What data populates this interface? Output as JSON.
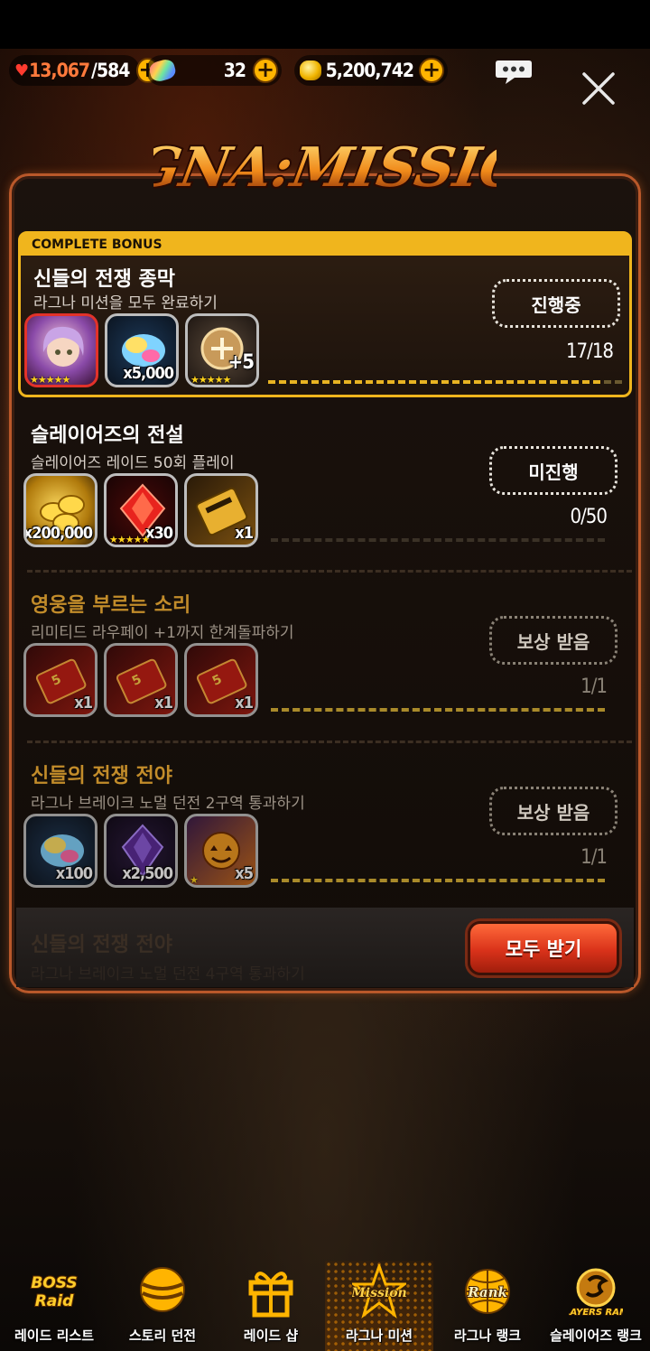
{
  "resources": {
    "stamina_current": "13,067",
    "stamina_max": "/584",
    "gems": "32",
    "gold": "5,200,742"
  },
  "title_logo_text": "RAGNA:MISSION",
  "missions": [
    {
      "section_label": "COMPLETE BONUS",
      "title": "신들의 전쟁 종막",
      "desc": "라그나 미션을 모두 완료하기",
      "button": "진행중",
      "progress": "17/18",
      "progress_fraction": 0.94,
      "rewards": [
        {
          "icon": "hero-portrait-icon",
          "qty": "",
          "stars": "★★★★★"
        },
        {
          "icon": "rainbow-gem-icon",
          "qty": "x5,000",
          "stars": ""
        },
        {
          "icon": "plus5-enhance-icon",
          "qty": "+5",
          "stars": "★★★★★"
        }
      ]
    },
    {
      "title": "슬레이어즈의 전설",
      "desc": "슬레이어즈 레이드 50회 플레이",
      "button": "미진행",
      "progress": "0/50",
      "progress_fraction": 0,
      "rewards": [
        {
          "icon": "gold-coins-icon",
          "qty": "x200,000",
          "stars": ""
        },
        {
          "icon": "red-crystal-icon",
          "qty": "x30",
          "stars": "★★★★★"
        },
        {
          "icon": "gold-ticket-icon",
          "qty": "x1",
          "stars": ""
        }
      ]
    },
    {
      "title": "영웅을 부르는 소리",
      "desc": "리미티드 라우페이 +1까지 한계돌파하기",
      "button": "보상 받음",
      "progress": "1/1",
      "progress_fraction": 1,
      "rewards": [
        {
          "icon": "red-ticket-icon",
          "qty": "x1",
          "stars": ""
        },
        {
          "icon": "red-ticket-icon",
          "qty": "x1",
          "stars": ""
        },
        {
          "icon": "red-ticket-icon",
          "qty": "x1",
          "stars": ""
        }
      ]
    },
    {
      "title": "신들의 전쟁 전야",
      "desc": "라그나 브레이크 노멀 던전 2구역 통과하기",
      "button": "보상 받음",
      "progress": "1/1",
      "progress_fraction": 1,
      "rewards": [
        {
          "icon": "rainbow-gem-icon",
          "qty": "x100",
          "stars": ""
        },
        {
          "icon": "purple-crystal-icon",
          "qty": "x2,500",
          "stars": ""
        },
        {
          "icon": "pumpkin-ticket-icon",
          "qty": "x5",
          "stars": "★"
        }
      ]
    }
  ],
  "ghost_row": {
    "title": "신들의 전쟁 전야",
    "desc": "라그나 브레이크 노멀 던전 4구역 통과하기"
  },
  "claim_all_label": "모두 받기",
  "nav": [
    {
      "label": "레이드 리스트",
      "icon": "boss-raid-icon",
      "active": false
    },
    {
      "label": "스토리 던전",
      "icon": "story-orb-icon",
      "active": false
    },
    {
      "label": "레이드 샵",
      "icon": "gift-box-icon",
      "active": false
    },
    {
      "label": "라그나 미션",
      "icon": "mission-star-icon",
      "active": true
    },
    {
      "label": "라그나 랭크",
      "icon": "rank-globe-icon",
      "active": false
    },
    {
      "label": "슬레이어즈 랭크",
      "icon": "slayers-rank-icon",
      "active": false
    }
  ],
  "colors": {
    "accent_gold": "#f0b51d",
    "panel_border": "#b9582a",
    "claim_button": "#d9321a"
  }
}
